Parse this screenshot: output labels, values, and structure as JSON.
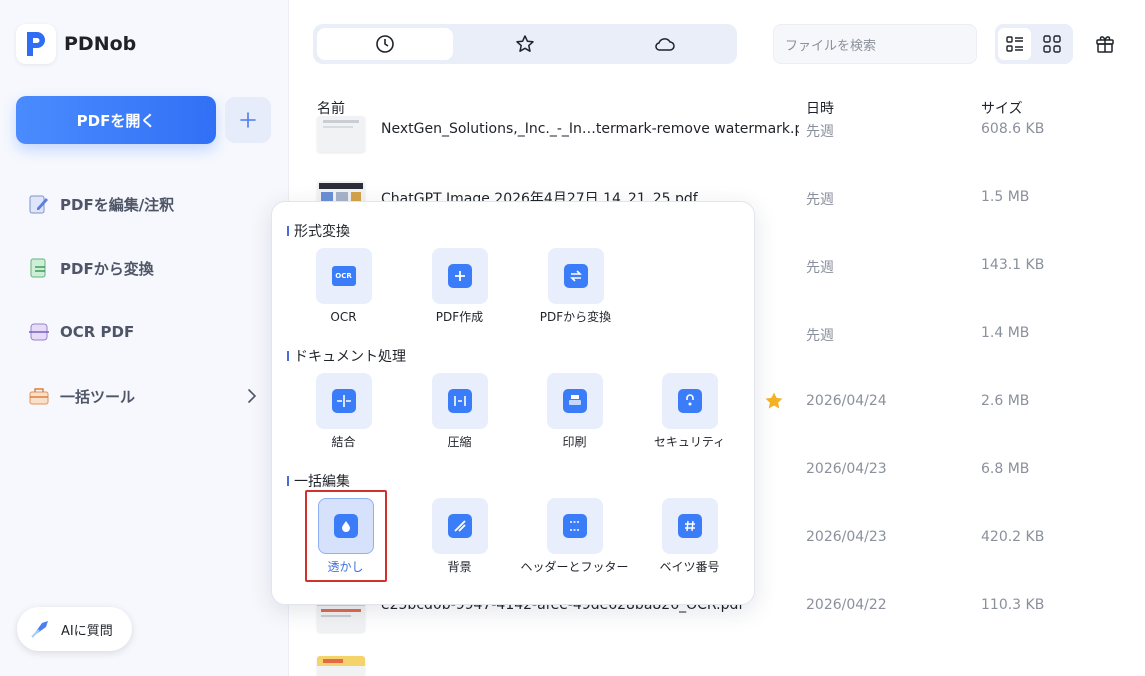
{
  "app": {
    "name": "PDNob"
  },
  "sidebar": {
    "open_button": "PDFを開く",
    "items": [
      {
        "label": "PDFを編集/注釈",
        "icon": "pen-doc-icon"
      },
      {
        "label": "PDFから変換",
        "icon": "convert-doc-icon"
      },
      {
        "label": "OCR PDF",
        "icon": "ocr-icon"
      },
      {
        "label": "一括ツール",
        "icon": "toolbox-icon"
      }
    ],
    "ai_button": "AIに質問"
  },
  "header": {
    "tabs": [
      {
        "icon": "clock-icon",
        "active": true
      },
      {
        "icon": "star-icon",
        "active": false
      },
      {
        "icon": "cloud-icon",
        "active": false
      }
    ],
    "search_placeholder": "ファイルを検索"
  },
  "table": {
    "columns": {
      "name": "名前",
      "date": "日時",
      "size": "サイズ"
    },
    "rows": [
      {
        "name": "NextGen_Solutions,_Inc._-_In…termark-remove watermark.pdf",
        "date": "先週",
        "size": "608.6 KB"
      },
      {
        "name": "ChatGPT Image 2026年4月27日 14_21_25.pdf",
        "date": "先週",
        "size": "1.5 MB"
      },
      {
        "name": "",
        "date": "先週",
        "size": "143.1 KB"
      },
      {
        "name": "",
        "date": "先週",
        "size": "1.4 MB"
      },
      {
        "name": "",
        "date": "2026/04/24",
        "size": "2.6 MB",
        "starred": true
      },
      {
        "name": "",
        "date": "2026/04/23",
        "size": "6.8 MB"
      },
      {
        "name": "",
        "date": "2026/04/23",
        "size": "420.2 KB"
      },
      {
        "name": "e25bcd0b-9947-4142-afee-49de628ba826_OCR.pdf",
        "date": "2026/04/22",
        "size": "110.3 KB"
      }
    ]
  },
  "popup": {
    "sections": [
      {
        "title": "形式変換",
        "tools": [
          "OCR",
          "PDF作成",
          "PDFから変換"
        ]
      },
      {
        "title": "ドキュメント処理",
        "tools": [
          "結合",
          "圧縮",
          "印刷",
          "セキュリティ"
        ]
      },
      {
        "title": "一括編集",
        "tools": [
          "透かし",
          "背景",
          "ヘッダーとフッター",
          "ベイツ番号"
        ]
      }
    ],
    "ocr_icon_text": "OCR",
    "selected_tool": "透かし"
  },
  "colors": {
    "accent": "#3b7df8",
    "highlight": "#d2322d",
    "star": "#f5b324"
  }
}
